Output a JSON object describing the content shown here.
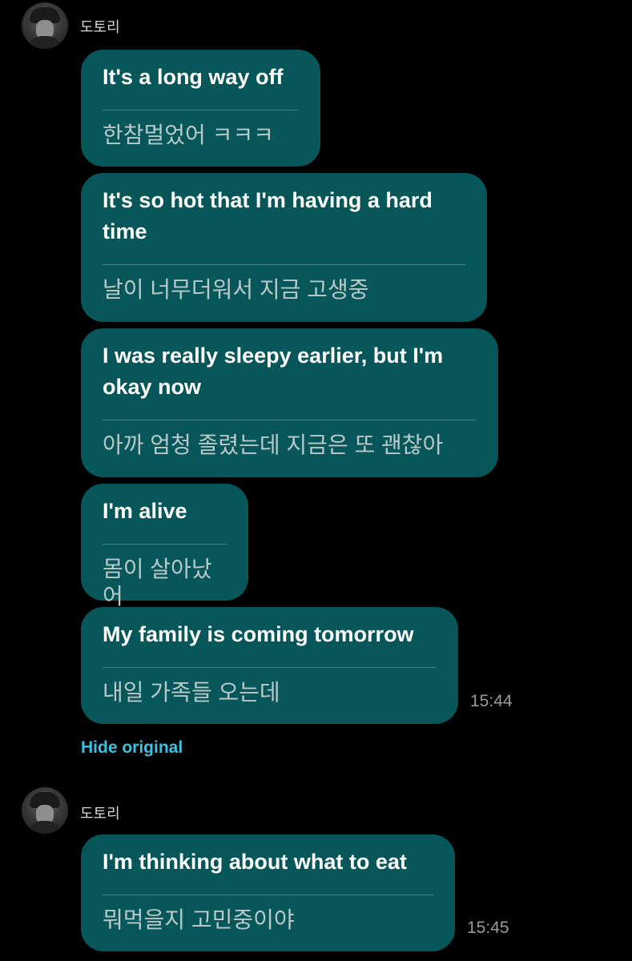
{
  "groups": [
    {
      "sender": "도토리",
      "messages": [
        {
          "original": "It's a long way off",
          "translation": "한참멀었어 ㅋㅋㅋ"
        },
        {
          "original": "It's so hot that I'm having a hard time",
          "translation": "날이 너무더워서 지금 고생중"
        },
        {
          "original": "I was really sleepy earlier, but I'm okay now",
          "translation": "아까 엄청 졸렸는데 지금은 또 괜찮아"
        },
        {
          "original": "I'm alive",
          "translation": "몸이 살아났어"
        },
        {
          "original": "My family is coming tomorrow",
          "translation": "내일 가족들 오는데",
          "time": "15:44"
        }
      ],
      "hide_original_label": "Hide original"
    },
    {
      "sender": "도토리",
      "messages": [
        {
          "original": "I'm thinking about what to eat",
          "translation": "뭐먹을지 고민중이야",
          "time": "15:45"
        }
      ]
    }
  ],
  "colors": {
    "background": "#000000",
    "bubble": "#07575a",
    "link": "#38c3e0",
    "timestamp": "#9a9a9a"
  },
  "icons": {
    "avatar": "profile-photo"
  }
}
